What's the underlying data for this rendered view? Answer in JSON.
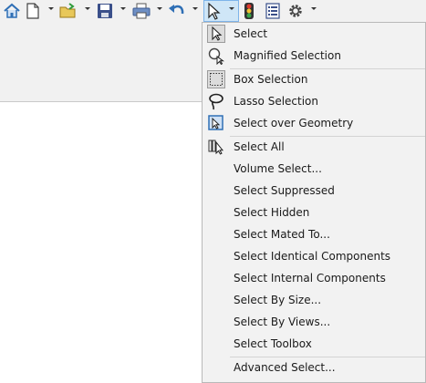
{
  "toolbar": {
    "icons": [
      "home-icon",
      "new-document-icon",
      "open-folder-icon",
      "save-icon",
      "print-icon",
      "undo-icon",
      "select-arrow-icon",
      "traffic-light-icon",
      "file-properties-icon",
      "options-gear-icon"
    ]
  },
  "menu": {
    "items": [
      {
        "label": "Select",
        "icon": "select-arrow-icon"
      },
      {
        "label": "Magnified Selection",
        "icon": "magnified-selection-icon"
      },
      {
        "label": "Box Selection",
        "icon": "box-selection-icon"
      },
      {
        "label": "Lasso Selection",
        "icon": "lasso-selection-icon"
      },
      {
        "label": "Select over Geometry",
        "icon": "select-over-geometry-icon"
      },
      {
        "label": "Select All",
        "icon": "select-all-icon"
      },
      {
        "label": "Volume Select...",
        "icon": ""
      },
      {
        "label": "Select Suppressed",
        "icon": ""
      },
      {
        "label": "Select Hidden",
        "icon": ""
      },
      {
        "label": "Select Mated To...",
        "icon": ""
      },
      {
        "label": "Select Identical Components",
        "icon": ""
      },
      {
        "label": "Select Internal Components",
        "icon": ""
      },
      {
        "label": "Select By Size...",
        "icon": ""
      },
      {
        "label": "Select By Views...",
        "icon": ""
      },
      {
        "label": "Select Toolbox",
        "icon": ""
      },
      {
        "label": "Advanced Select...",
        "icon": ""
      }
    ]
  },
  "colors": {
    "accent": "#2f6fb5",
    "menu_bg": "#f2f2f2",
    "toolbar_bg": "#f1f1f1"
  }
}
